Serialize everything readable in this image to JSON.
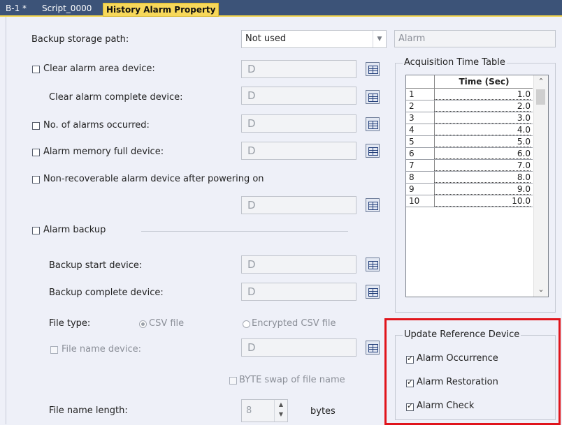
{
  "tabs": [
    {
      "label": "B-1 *"
    },
    {
      "label": "Script_0000"
    },
    {
      "label": "History Alarm Property"
    }
  ],
  "form": {
    "backup_storage_path": {
      "label": "Backup storage path:",
      "value": "Not used"
    },
    "alarm_field": "Alarm",
    "clear_alarm_area": {
      "label": "Clear alarm area device:",
      "value": "D"
    },
    "clear_alarm_complete": {
      "label": "Clear alarm complete device:",
      "value": "D"
    },
    "num_alarms": {
      "label": "No. of alarms occurred:",
      "value": "D"
    },
    "memory_full": {
      "label": "Alarm memory full device:",
      "value": "D"
    },
    "non_recoverable": {
      "label": "Non-recoverable alarm device after powering on",
      "value": "D"
    },
    "alarm_backup": {
      "label": "Alarm backup"
    },
    "backup_start": {
      "label": "Backup start device:",
      "value": "D"
    },
    "backup_complete": {
      "label": "Backup complete device:",
      "value": "D"
    },
    "file_type": {
      "label": "File type:",
      "option_csv": "CSV file",
      "option_encrypted": "Encrypted CSV file"
    },
    "file_name_device": {
      "label": "File name device:",
      "value": "D"
    },
    "byte_swap": {
      "label": "BYTE swap of file name"
    },
    "file_name_length": {
      "label": "File name length:",
      "value": "8",
      "unit": "bytes"
    }
  },
  "acquisition": {
    "title": "Acquisition Time Table",
    "column": "Time (Sec)",
    "rows": [
      {
        "n": "1",
        "v": "1.0"
      },
      {
        "n": "2",
        "v": "2.0"
      },
      {
        "n": "3",
        "v": "3.0"
      },
      {
        "n": "4",
        "v": "4.0"
      },
      {
        "n": "5",
        "v": "5.0"
      },
      {
        "n": "6",
        "v": "6.0"
      },
      {
        "n": "7",
        "v": "7.0"
      },
      {
        "n": "8",
        "v": "8.0"
      },
      {
        "n": "9",
        "v": "9.0"
      },
      {
        "n": "10",
        "v": "10.0"
      }
    ]
  },
  "update_reference": {
    "title": "Update Reference Device",
    "items": [
      {
        "label": "Alarm Occurrence",
        "checked": true
      },
      {
        "label": "Alarm Restoration",
        "checked": true
      },
      {
        "label": "Alarm Check",
        "checked": true
      }
    ]
  },
  "colors": {
    "highlight": "#e0141b",
    "tab_active": "#f7d85a",
    "tab_bar": "#3c5378"
  },
  "icons": [
    "device-browse-icon",
    "chevron-down-icon",
    "spin-up-icon",
    "spin-down-icon"
  ]
}
